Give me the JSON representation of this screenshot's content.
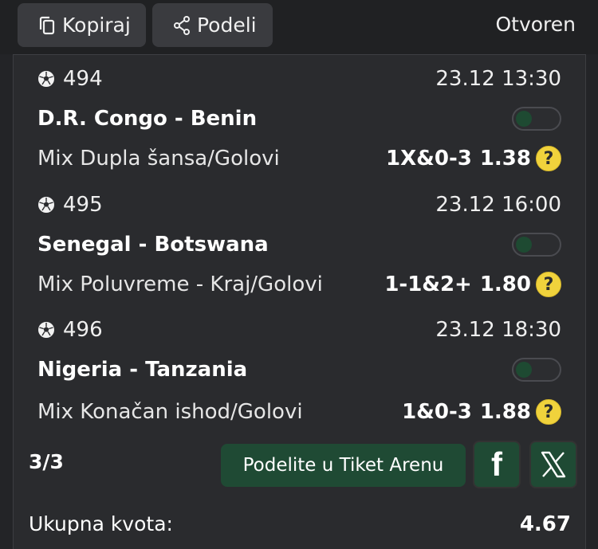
{
  "header": {
    "copy_label": "Kopiraj",
    "share_label": "Podeli",
    "status": "Otvoren"
  },
  "matches": [
    {
      "number": "494",
      "datetime": "23.12 13:30",
      "teams": "D.R. Congo - Benin",
      "market": "Mix Dupla šansa/Golovi",
      "pick": "1X&0-3",
      "odd": "1.38"
    },
    {
      "number": "495",
      "datetime": "23.12 16:00",
      "teams": "Senegal - Botswana",
      "market": "Mix Poluvreme - Kraj/Golovi",
      "pick": "1-1&2+",
      "odd": "1.80"
    },
    {
      "number": "496",
      "datetime": "23.12 18:30",
      "teams": "Nigeria - Tanzania",
      "market": "Mix Konačan ishod/Golovi",
      "pick": "1&0-3",
      "odd": "1.88"
    }
  ],
  "footer": {
    "count": "3/3",
    "arena_button": "Podelite u Tiket Arenu",
    "total_label": "Ukupna kvota:",
    "total_value": "4.67"
  },
  "colors": {
    "accent_green": "#1f4a34",
    "help_yellow": "#f0d23c",
    "background": "#232427"
  }
}
